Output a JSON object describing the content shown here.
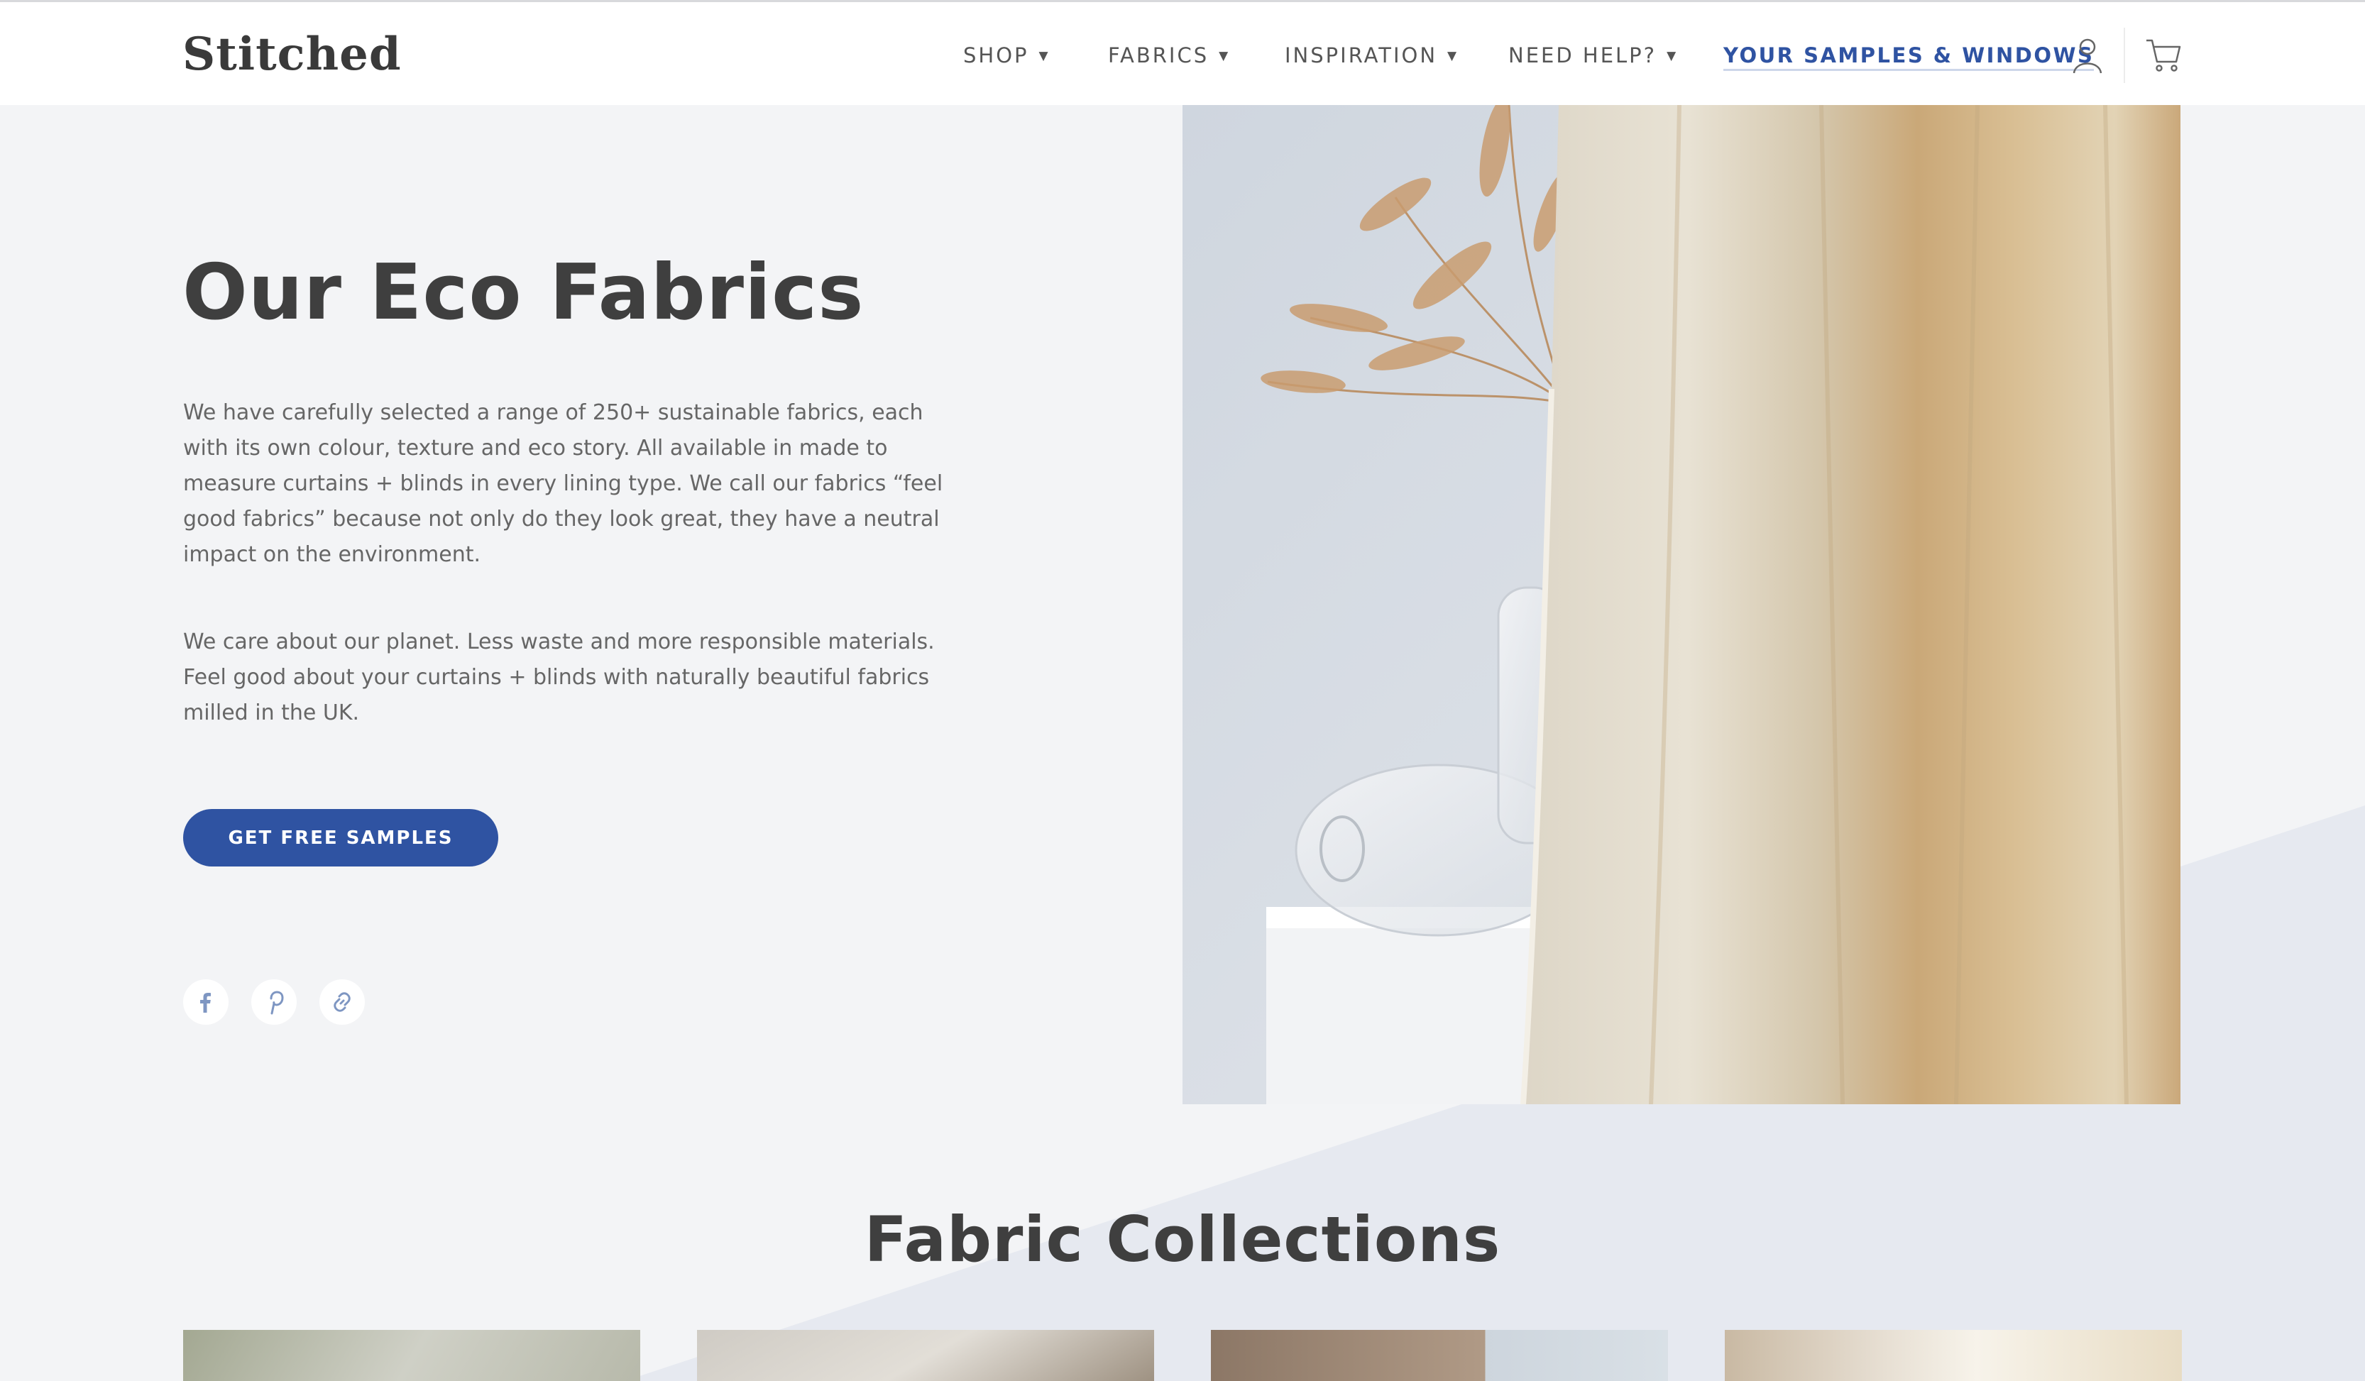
{
  "brand": {
    "logo": "Stitched"
  },
  "nav": {
    "items": [
      {
        "label": "SHOP"
      },
      {
        "label": "FABRICS"
      },
      {
        "label": "INSPIRATION"
      },
      {
        "label": "NEED HELP?"
      }
    ],
    "caret_icon": "caret-down-icon",
    "samples_label": "YOUR SAMPLES & WINDOWS",
    "account_icon": "user-icon",
    "cart_icon": "cart-icon"
  },
  "hero": {
    "title": "Our Eco Fabrics",
    "paragraph_1": "We have carefully selected a range of 250+ sustainable fabrics, each with its own colour, texture and eco story. All available in made to measure curtains + blinds in every lining type. We call our fabrics “feel good fabrics” because not only do they look great, they have a neutral impact on the environment.",
    "paragraph_2": "We care about our planet. Less waste and more responsible materials. Feel good about your curtains + blinds with naturally beautiful fabrics milled in the UK.",
    "cta_label": "GET FREE SAMPLES",
    "social_icons": [
      "facebook-icon",
      "pinterest-icon",
      "link-icon"
    ]
  },
  "collections": {
    "title": "Fabric Collections"
  },
  "colors": {
    "accent": "#2f53a2",
    "background": "#f3f4f6",
    "header": "#ffffff",
    "text": "#3f3f3f"
  }
}
